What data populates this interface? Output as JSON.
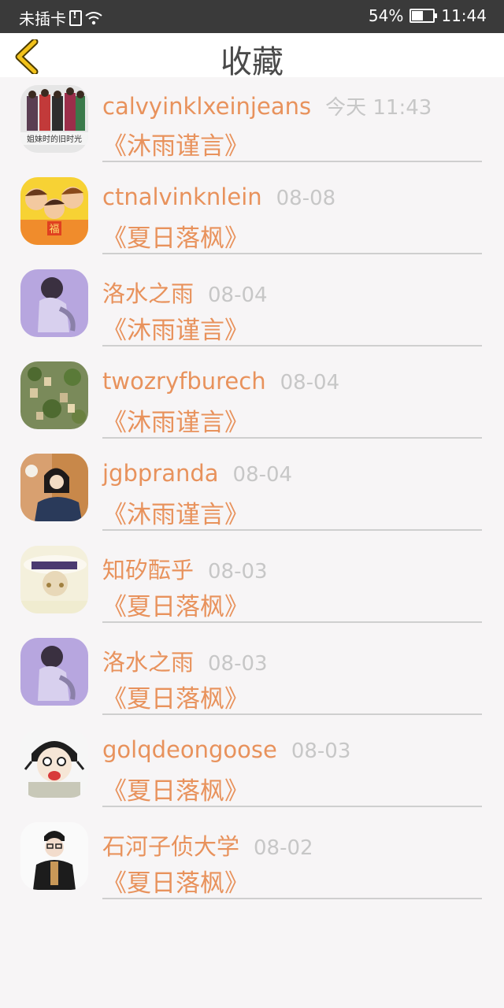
{
  "status_bar": {
    "carrier": "未插卡",
    "battery_percent": "54%",
    "battery_level": 0.54,
    "time": "11:44"
  },
  "header": {
    "title": "收藏"
  },
  "favorites": [
    {
      "user": "calvyinklxeinjeans",
      "time": "今天 11:43",
      "book": "《沐雨谨言》",
      "avatar_caption": "姐妹时的旧时光"
    },
    {
      "user": "ctnalvinknlein",
      "time": "08-08",
      "book": "《夏日落枫》",
      "avatar_caption": "福"
    },
    {
      "user": "洛水之雨",
      "time": "08-04",
      "book": "《沐雨谨言》"
    },
    {
      "user": "twozryfburech",
      "time": "08-04",
      "book": "《沐雨谨言》"
    },
    {
      "user": "jgbpranda",
      "time": "08-04",
      "book": "《沐雨谨言》"
    },
    {
      "user": "知矽酝乎",
      "time": "08-03",
      "book": "《夏日落枫》"
    },
    {
      "user": "洛水之雨",
      "time": "08-03",
      "book": "《夏日落枫》"
    },
    {
      "user": "golqdeongoose",
      "time": "08-03",
      "book": "《夏日落枫》"
    },
    {
      "user": "石河子侦大学",
      "time": "08-02",
      "book": "《夏日落枫》"
    }
  ],
  "colors": {
    "accent": "#e8925c",
    "back_icon": "#f2c21b",
    "muted": "#c7c7c7",
    "statusbar": "#3a3a3a"
  }
}
